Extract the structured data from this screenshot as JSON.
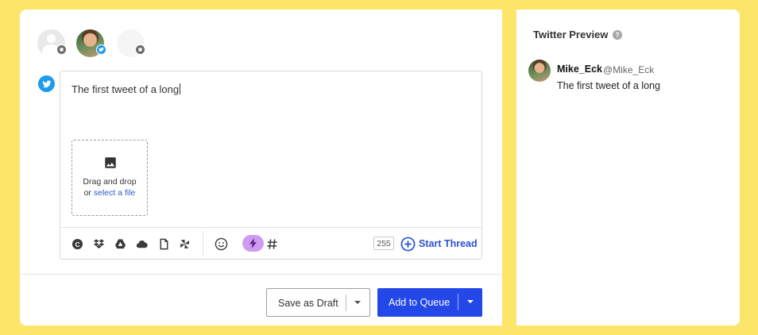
{
  "composer": {
    "accounts": [
      {
        "name": "generic-account",
        "badge": "social-network"
      },
      {
        "name": "Mike_Eck",
        "badge": "twitter"
      },
      {
        "name": "generic-account-2",
        "badge": "social-network"
      }
    ],
    "editor_text": "The first tweet of a long",
    "dropzone": {
      "line1": "Drag and drop",
      "line2_prefix": "or ",
      "link": "select a file"
    },
    "toolbar": {
      "icons": [
        "content-library-icon",
        "dropbox-icon",
        "google-drive-icon",
        "onedrive-icon",
        "document-icon",
        "pinwheel-icon",
        "emoji-icon",
        "lightning-icon",
        "hashtag-icon"
      ],
      "char_count": "255",
      "start_thread": "Start Thread"
    },
    "buttons": {
      "save_draft": "Save as Draft",
      "add_to_queue": "Add to Queue"
    },
    "colors": {
      "twitter": "#1d9bf0",
      "primary": "#2447e8",
      "link": "#2b52cf",
      "highlight": "#cf9bf2",
      "background": "#fde56a"
    }
  },
  "preview": {
    "title": "Twitter Preview",
    "help": "?",
    "name": "Mike_Eck",
    "handle": "@Mike_Eck",
    "text": "The first tweet of a long"
  }
}
